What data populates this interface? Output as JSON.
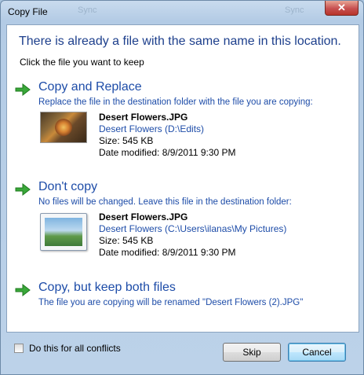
{
  "window": {
    "title": "Copy File",
    "ghost_tabs": [
      "Sync",
      "Sync"
    ]
  },
  "dialog": {
    "headline": "There is already a file with the same name in this location.",
    "subhead": "Click the file you want to keep"
  },
  "options": [
    {
      "title": "Copy and Replace",
      "description": "Replace the file in the destination folder with the file you are copying:",
      "file": {
        "name": "Desert Flowers.JPG",
        "path": "Desert Flowers (D:\\Edits)",
        "size": "Size: 545 KB",
        "modified": "Date modified: 8/9/2011 9:30 PM"
      }
    },
    {
      "title": "Don't copy",
      "description": "No files will be changed. Leave this file in the destination folder:",
      "file": {
        "name": "Desert Flowers.JPG",
        "path": "Desert Flowers (C:\\Users\\ilanas\\My Pictures)",
        "size": "Size: 545 KB",
        "modified": "Date modified: 8/9/2011 9:30 PM"
      }
    },
    {
      "title": "Copy, but keep both files",
      "description": "The file you are copying will be renamed \"Desert Flowers (2).JPG\""
    }
  ],
  "footer": {
    "checkbox_label": "Do this for all conflicts",
    "checkbox_checked": false,
    "skip_label": "Skip",
    "cancel_label": "Cancel"
  },
  "colors": {
    "accent_text": "#1d4ca8",
    "headline": "#1d3f8c",
    "arrow": "#3aa83a"
  }
}
